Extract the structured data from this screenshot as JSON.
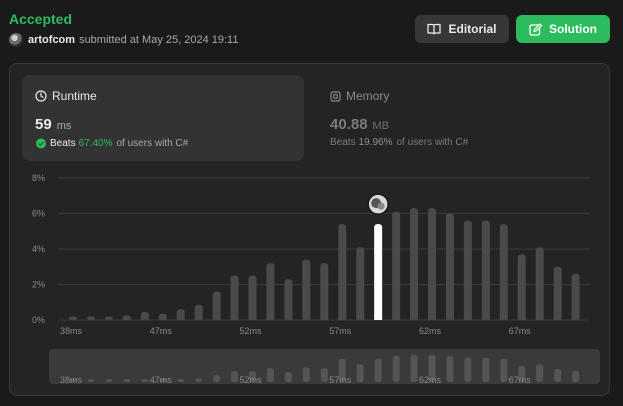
{
  "header": {
    "status": "Accepted",
    "username": "artofcom",
    "submitted_text": "submitted at May 25, 2024 19:11",
    "editorial_label": "Editorial",
    "solution_label": "Solution"
  },
  "runtime": {
    "label": "Runtime",
    "value": "59",
    "unit": "ms",
    "beats_label": "Beats",
    "beats_percent": "67.40%",
    "beats_suffix": "of users with C#"
  },
  "memory": {
    "label": "Memory",
    "value": "40.88",
    "unit": "MB",
    "beats_label": "Beats",
    "beats_percent": "19.96%",
    "beats_suffix": "of users with C#"
  },
  "colors": {
    "accent": "#2cbb5d",
    "bar": "#4a4a4a",
    "bar_highlight": "#ffffff",
    "grid": "#3a3a3a"
  },
  "chart_data": {
    "type": "bar",
    "title": "",
    "xlabel": "",
    "ylabel": "",
    "ylim": [
      0,
      8
    ],
    "y_ticks": [
      "0%",
      "2%",
      "4%",
      "6%",
      "8%"
    ],
    "x_tick_labels": [
      "38ms",
      "47ms",
      "52ms",
      "57ms",
      "62ms",
      "67ms"
    ],
    "x_tick_bar_index": [
      0,
      5,
      10,
      15,
      20,
      25
    ],
    "highlight_index": 17,
    "highlight_marker_icon": "user-avatar-icon",
    "grid": true,
    "values": [
      0.2,
      0.2,
      0.2,
      0.25,
      0.45,
      0.35,
      0.6,
      0.85,
      1.6,
      2.5,
      2.5,
      3.2,
      2.3,
      3.4,
      3.2,
      5.4,
      4.1,
      5.4,
      6.1,
      6.3,
      6.3,
      6.0,
      5.6,
      5.6,
      5.4,
      3.7,
      4.1,
      3.0,
      2.6
    ],
    "navigator": {
      "values": [
        0.2,
        0.2,
        0.2,
        0.25,
        0.45,
        0.35,
        0.6,
        0.85,
        1.6,
        2.5,
        2.5,
        3.2,
        2.3,
        3.4,
        3.2,
        5.4,
        4.1,
        5.4,
        6.1,
        6.3,
        6.3,
        6.0,
        5.6,
        5.6,
        5.4,
        3.7,
        4.1,
        3.0,
        2.6
      ],
      "x_tick_labels": [
        "38ms",
        "47ms",
        "52ms",
        "57ms",
        "62ms",
        "67ms"
      ]
    }
  }
}
